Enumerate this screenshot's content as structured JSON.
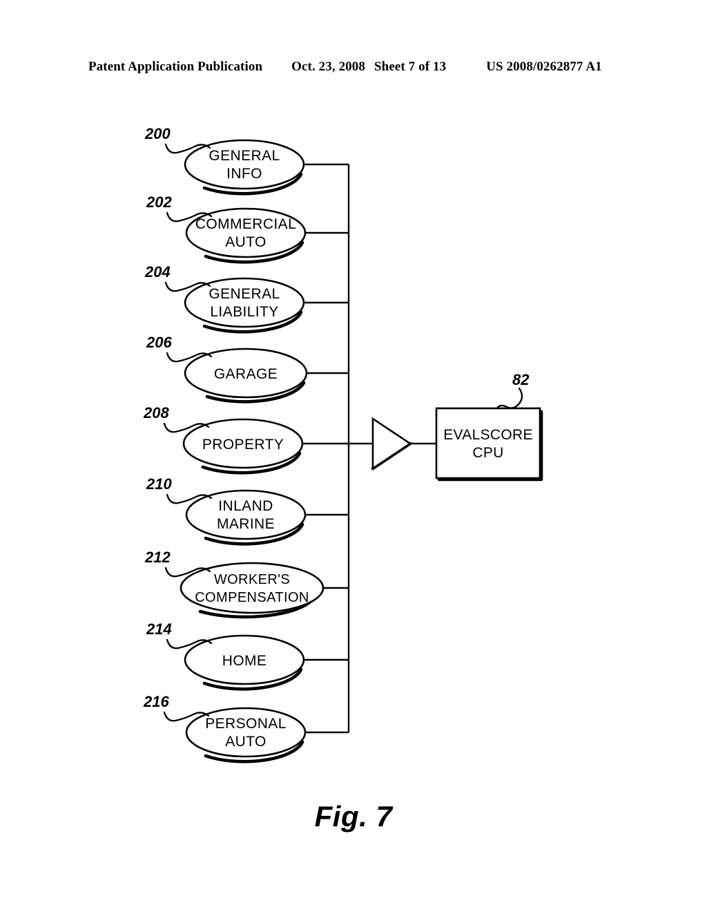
{
  "header": {
    "publication": "Patent Application Publication",
    "date": "Oct. 23, 2008",
    "sheet": "Sheet 7 of 13",
    "patent_number": "US 2008/0262877 A1"
  },
  "figure": {
    "caption": "Fig. 7",
    "nodes": [
      {
        "ref": "200",
        "label_line1": "GENERAL",
        "label_line2": "INFO"
      },
      {
        "ref": "202",
        "label_line1": "COMMERCIAL",
        "label_line2": "AUTO"
      },
      {
        "ref": "204",
        "label_line1": "GENERAL",
        "label_line2": "LIABILITY"
      },
      {
        "ref": "206",
        "label_line1": "GARAGE",
        "label_line2": ""
      },
      {
        "ref": "208",
        "label_line1": "PROPERTY",
        "label_line2": ""
      },
      {
        "ref": "210",
        "label_line1": "INLAND",
        "label_line2": "MARINE"
      },
      {
        "ref": "212",
        "label_line1": "WORKER'S",
        "label_line2": "COMPENSATION"
      },
      {
        "ref": "214",
        "label_line1": "HOME",
        "label_line2": ""
      },
      {
        "ref": "216",
        "label_line1": "PERSONAL",
        "label_line2": "AUTO"
      }
    ],
    "cpu": {
      "ref": "82",
      "label_line1": "EVALSCORE",
      "label_line2": "CPU"
    },
    "colors": {
      "ink": "#000000",
      "paper": "#ffffff"
    }
  }
}
